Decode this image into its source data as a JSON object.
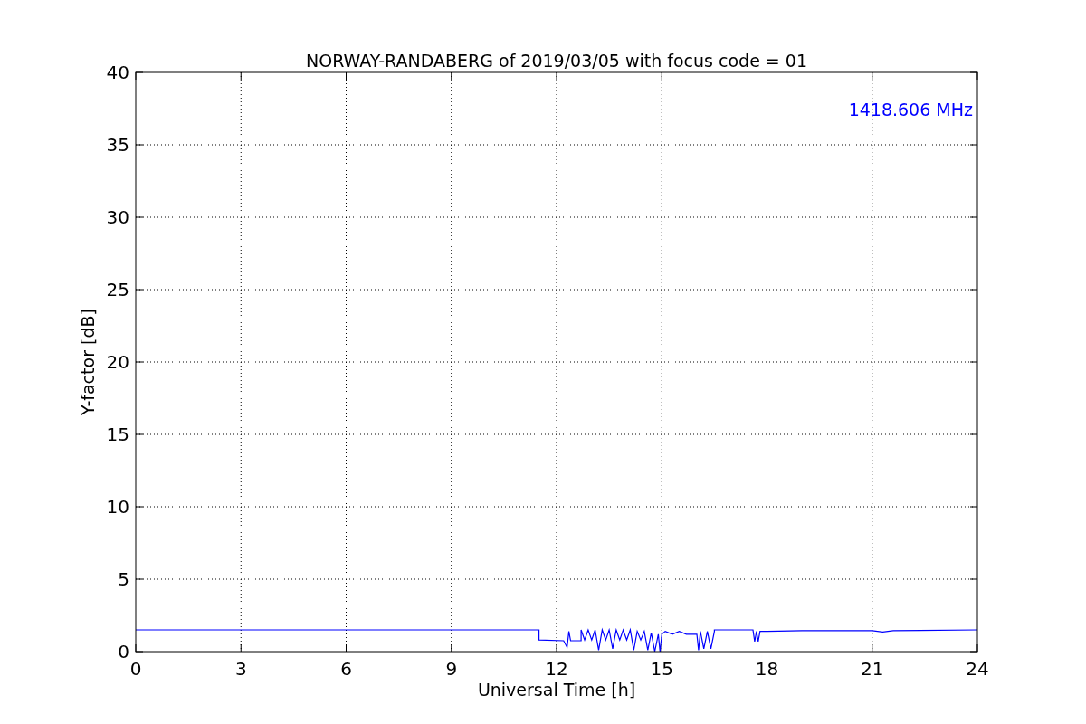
{
  "chart_data": {
    "type": "line",
    "title": "NORWAY-RANDABERG of 2019/03/05 with focus code = 01",
    "xlabel": "Universal Time [h]",
    "ylabel": "Y-factor [dB]",
    "x": [
      0,
      11.5,
      11.5,
      12.2,
      12.3,
      12.35,
      12.4,
      12.7,
      12.7,
      12.8,
      12.9,
      13.0,
      13.1,
      13.2,
      13.3,
      13.4,
      13.5,
      13.6,
      13.7,
      13.8,
      13.9,
      14.0,
      14.1,
      14.2,
      14.3,
      14.4,
      14.5,
      14.6,
      14.7,
      14.8,
      14.9,
      14.95,
      15.0,
      15.1,
      15.3,
      15.5,
      15.7,
      16.0,
      16.05,
      16.1,
      16.2,
      16.3,
      16.4,
      16.5,
      16.5,
      17.6,
      17.65,
      17.7,
      17.75,
      17.8,
      18,
      19,
      21,
      21.3,
      21.6,
      24
    ],
    "series": [
      {
        "name": "1418.606 MHz",
        "color": "#0000ff",
        "values": [
          1.5,
          1.5,
          0.8,
          0.75,
          0.3,
          1.4,
          0.75,
          0.75,
          1.5,
          0.8,
          1.5,
          0.8,
          1.5,
          0.1,
          1.5,
          0.8,
          1.5,
          0.2,
          1.5,
          0.8,
          1.5,
          0.8,
          1.5,
          0.1,
          1.4,
          0.8,
          1.4,
          0.1,
          1.3,
          0,
          1.2,
          0,
          1.2,
          1.4,
          1.2,
          1.4,
          1.2,
          1.2,
          0.1,
          1.4,
          0.2,
          1.4,
          0.2,
          1.4,
          1.5,
          1.5,
          0.7,
          1.4,
          0.7,
          1.4,
          1.4,
          1.45,
          1.45,
          1.35,
          1.45,
          1.5
        ]
      }
    ],
    "xlim": [
      0,
      24
    ],
    "ylim": [
      0,
      40
    ],
    "xticks": [
      0,
      3,
      6,
      9,
      12,
      15,
      18,
      21,
      24
    ],
    "yticks": [
      0,
      5,
      10,
      15,
      20,
      25,
      30,
      35,
      40
    ],
    "grid": true
  }
}
